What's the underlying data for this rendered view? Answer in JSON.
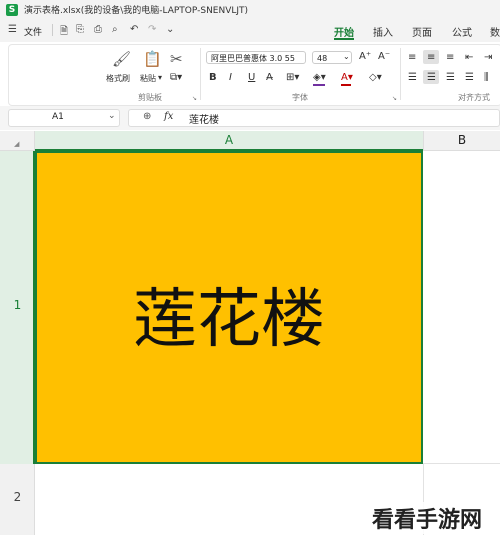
{
  "window": {
    "app_icon_letter": "S",
    "title": "演示表格.xlsx(我的设备\\我的电脑-LAPTOP-SNENVLJT)"
  },
  "menu": {
    "file_label": "文件",
    "tabs": [
      {
        "label": "开始",
        "active": true
      },
      {
        "label": "插入"
      },
      {
        "label": "页面"
      },
      {
        "label": "公式"
      },
      {
        "label": "数"
      }
    ]
  },
  "ribbon": {
    "clipboard": {
      "format_painter_label": "格式刷",
      "paste_label": "粘贴",
      "group_label": "剪贴板"
    },
    "font": {
      "font_name": "阿里巴巴普惠体 3.0 55",
      "font_size": "48",
      "group_label": "字体",
      "bold": "B",
      "italic": "I",
      "underline": "U",
      "font_color": "#c00000",
      "fill_color": "#ffc000"
    },
    "alignment": {
      "group_label": "对齐方式"
    }
  },
  "formula_bar": {
    "cell_ref": "A1",
    "fx": "fx",
    "value": "莲花楼"
  },
  "grid": {
    "col_a": "A",
    "col_b": "B",
    "row_1": "1",
    "row_2": "2",
    "cell_a1": {
      "text": "莲花楼",
      "fill": "#ffc000"
    }
  },
  "watermark": "看看手游网"
}
